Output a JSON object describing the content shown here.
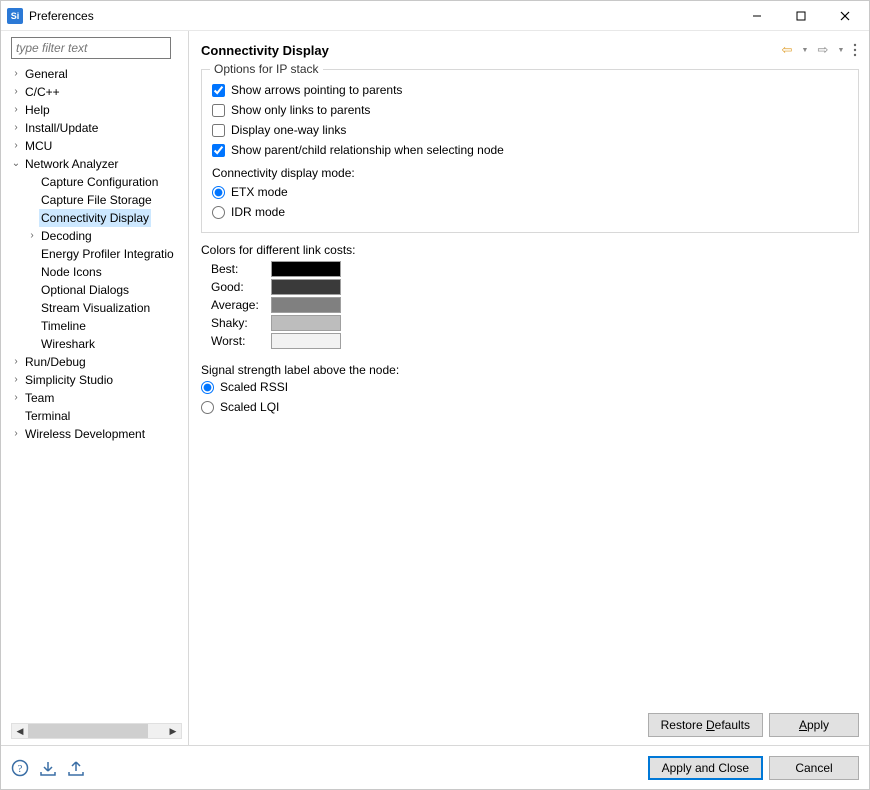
{
  "window": {
    "title": "Preferences",
    "app_icon_text": "Si"
  },
  "sidebar": {
    "filter_placeholder": "type filter text",
    "items": [
      {
        "label": "General",
        "depth": 0,
        "expand": "closed"
      },
      {
        "label": "C/C++",
        "depth": 0,
        "expand": "closed"
      },
      {
        "label": "Help",
        "depth": 0,
        "expand": "closed"
      },
      {
        "label": "Install/Update",
        "depth": 0,
        "expand": "closed"
      },
      {
        "label": "MCU",
        "depth": 0,
        "expand": "closed"
      },
      {
        "label": "Network Analyzer",
        "depth": 0,
        "expand": "open"
      },
      {
        "label": "Capture Configuration",
        "depth": 1,
        "expand": "none"
      },
      {
        "label": "Capture File Storage",
        "depth": 1,
        "expand": "none"
      },
      {
        "label": "Connectivity Display",
        "depth": 1,
        "expand": "none",
        "selected": true
      },
      {
        "label": "Decoding",
        "depth": 1,
        "expand": "closed"
      },
      {
        "label": "Energy Profiler Integratio",
        "depth": 1,
        "expand": "none"
      },
      {
        "label": "Node Icons",
        "depth": 1,
        "expand": "none"
      },
      {
        "label": "Optional Dialogs",
        "depth": 1,
        "expand": "none"
      },
      {
        "label": "Stream Visualization",
        "depth": 1,
        "expand": "none"
      },
      {
        "label": "Timeline",
        "depth": 1,
        "expand": "none"
      },
      {
        "label": "Wireshark",
        "depth": 1,
        "expand": "none"
      },
      {
        "label": "Run/Debug",
        "depth": 0,
        "expand": "closed"
      },
      {
        "label": "Simplicity Studio",
        "depth": 0,
        "expand": "closed"
      },
      {
        "label": "Team",
        "depth": 0,
        "expand": "closed"
      },
      {
        "label": "Terminal",
        "depth": 0,
        "expand": "none"
      },
      {
        "label": "Wireless Development",
        "depth": 0,
        "expand": "closed"
      }
    ]
  },
  "main": {
    "title": "Connectivity Display",
    "ip_group": {
      "legend": "Options for IP stack",
      "checks": [
        {
          "label": "Show arrows pointing to parents",
          "checked": true
        },
        {
          "label": "Show only links to parents",
          "checked": false
        },
        {
          "label": "Display one-way links",
          "checked": false
        },
        {
          "label": "Show parent/child relationship when selecting node",
          "checked": true
        }
      ],
      "mode_label": "Connectivity display mode:",
      "modes": [
        {
          "label": "ETX mode",
          "checked": true
        },
        {
          "label": "IDR mode",
          "checked": false
        }
      ]
    },
    "colors_label": "Colors for different link costs:",
    "colors": [
      {
        "label": "Best:",
        "hex": "#000000"
      },
      {
        "label": "Good:",
        "hex": "#3a3a3a"
      },
      {
        "label": "Average:",
        "hex": "#808080"
      },
      {
        "label": "Shaky:",
        "hex": "#bdbdbd"
      },
      {
        "label": "Worst:",
        "hex": "#f2f2f2"
      }
    ],
    "signal_label": "Signal strength label above the node:",
    "signal_options": [
      {
        "label": "Scaled RSSI",
        "checked": true
      },
      {
        "label": "Scaled LQI",
        "checked": false
      }
    ],
    "buttons": {
      "restore_defaults": "Restore Defaults",
      "restore_defaults_key": "D",
      "apply": "Apply",
      "apply_key": "A"
    }
  },
  "footer": {
    "apply_close": "Apply and Close",
    "cancel": "Cancel"
  }
}
